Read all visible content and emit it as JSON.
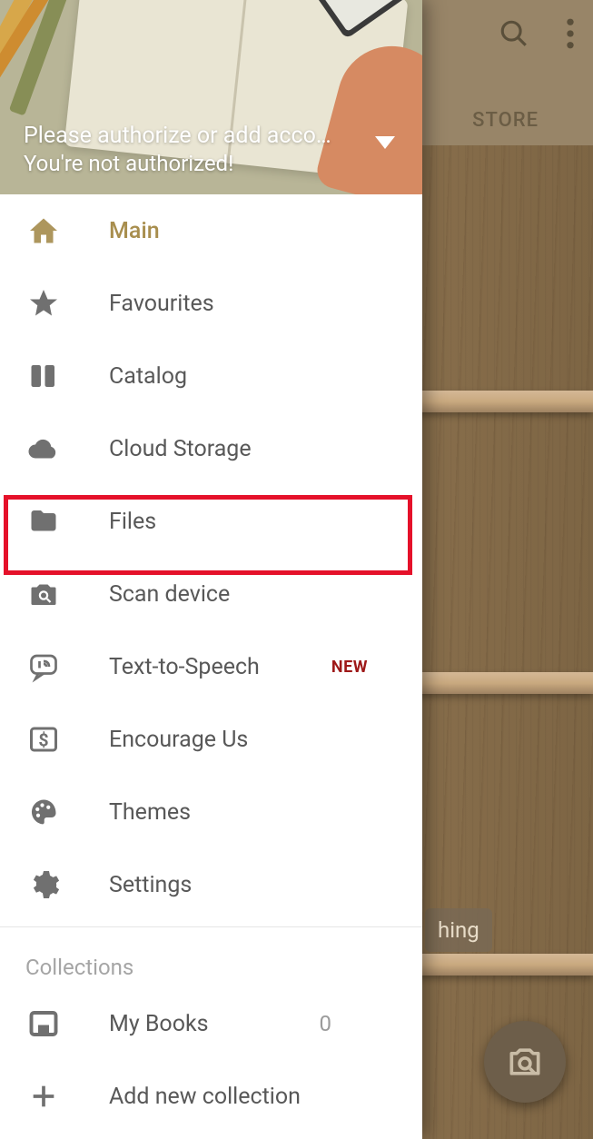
{
  "appbar": {
    "store_tab": "STORE",
    "hint_fragment": "hing"
  },
  "drawer": {
    "header": {
      "line1": "Please authorize or add acco…",
      "line2": "You're not authorized!"
    },
    "menu": [
      {
        "id": "main",
        "label": "Main",
        "icon": "home-icon",
        "active": true
      },
      {
        "id": "favourites",
        "label": "Favourites",
        "icon": "star-icon"
      },
      {
        "id": "catalog",
        "label": "Catalog",
        "icon": "books-icon"
      },
      {
        "id": "cloud",
        "label": "Cloud Storage",
        "icon": "cloud-icon"
      },
      {
        "id": "files",
        "label": "Files",
        "icon": "folder-icon",
        "highlighted": true
      },
      {
        "id": "scan",
        "label": "Scan device",
        "icon": "camera-search-icon"
      },
      {
        "id": "tts",
        "label": "Text-to-Speech",
        "icon": "speech-icon",
        "badge": "NEW"
      },
      {
        "id": "encourage",
        "label": "Encourage Us",
        "icon": "dollar-icon"
      },
      {
        "id": "themes",
        "label": "Themes",
        "icon": "palette-icon"
      },
      {
        "id": "settings",
        "label": "Settings",
        "icon": "gear-icon"
      }
    ],
    "collections_title": "Collections",
    "collections": [
      {
        "id": "mybooks",
        "label": "My Books",
        "icon": "inbox-icon",
        "count": 0
      },
      {
        "id": "addcollection",
        "label": "Add new collection",
        "icon": "plus-icon"
      }
    ]
  }
}
